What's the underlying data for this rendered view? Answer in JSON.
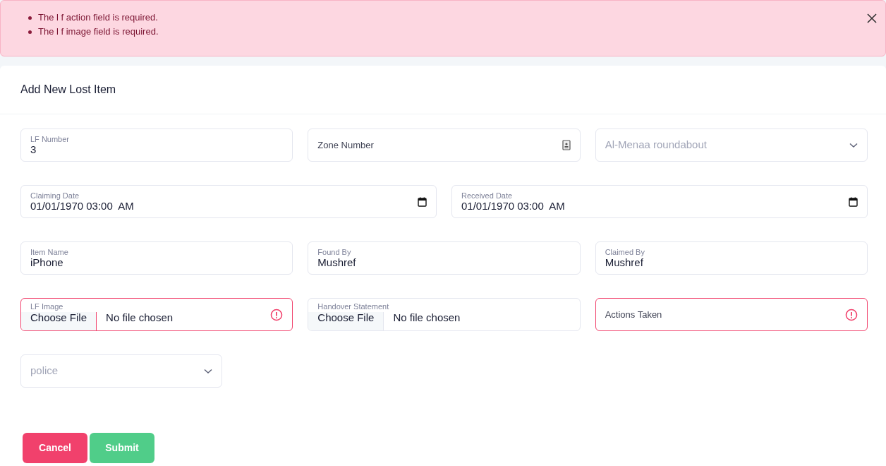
{
  "alert": {
    "errors": [
      "The l f action field is required.",
      "The l f image field is required."
    ]
  },
  "form": {
    "title": "Add New Lost Item",
    "rows": [
      [
        {
          "kind": "text",
          "label": "LF Number",
          "value": "3",
          "invalid": false
        },
        {
          "kind": "text_with_icon",
          "placeholder": "Zone Number",
          "invalid": false
        },
        {
          "kind": "select",
          "placeholder": "Al-Menaa roundabout",
          "invalid": false
        }
      ],
      [
        {
          "kind": "date",
          "label": "Claiming Date",
          "value": "01/01/1970 03:00  AM",
          "invalid": false
        },
        {
          "kind": "date",
          "label": "Received Date",
          "value": "01/01/1970 03:00  AM",
          "invalid": false
        }
      ],
      [
        {
          "kind": "text",
          "label": "Item Name",
          "value": "iPhone",
          "invalid": false
        },
        {
          "kind": "text",
          "label": "Found By",
          "value": "Mushref",
          "invalid": false
        },
        {
          "kind": "text",
          "label": "Claimed By",
          "value": "Mushref",
          "invalid": false
        }
      ],
      [
        {
          "kind": "file",
          "label": "LF Image",
          "button": "Choose File",
          "status": "No file chosen",
          "invalid": true
        },
        {
          "kind": "file",
          "label": "Handover Statement",
          "button": "Choose File",
          "status": "No file chosen",
          "invalid": false
        },
        {
          "kind": "text",
          "placeholder": "Actions Taken",
          "invalid": true
        }
      ],
      [
        {
          "kind": "select",
          "placeholder": "police",
          "invalid": false,
          "narrow": true
        }
      ]
    ],
    "buttons": [
      {
        "label": "Cancel",
        "kind": "danger"
      },
      {
        "label": "Submit",
        "kind": "success"
      }
    ]
  }
}
